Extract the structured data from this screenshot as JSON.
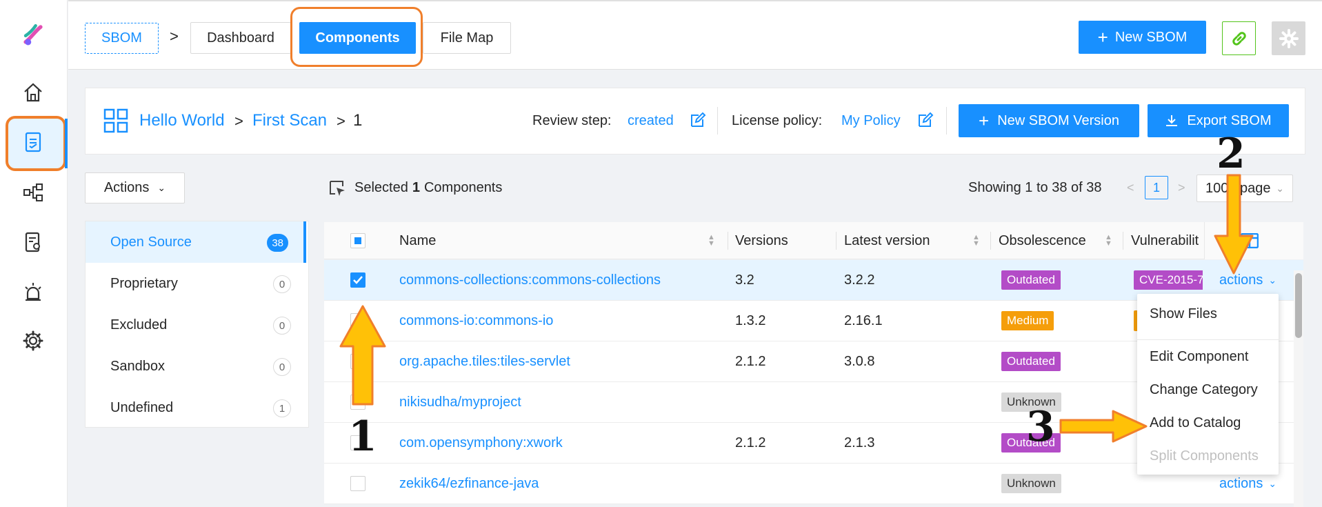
{
  "topbar": {
    "sbom_label": "SBOM",
    "breadcrumb_sep": ">",
    "tabs": [
      "Dashboard",
      "Components",
      "File Map"
    ],
    "new_sbom_label": "New SBOM"
  },
  "header": {
    "project": "Hello World",
    "scan": "First Scan",
    "version": "1",
    "sep": ">",
    "review_label": "Review step:",
    "review_value": "created",
    "license_label": "License policy:",
    "license_value": "My Policy",
    "new_version_label": "New SBOM Version",
    "export_label": "Export SBOM"
  },
  "toolbar": {
    "actions_label": "Actions",
    "selected_prefix": "Selected",
    "selected_count": "1",
    "selected_suffix": "Components",
    "showing": "Showing 1 to 38 of 38",
    "current_page": "1",
    "page_size": "100 / page"
  },
  "categories": [
    {
      "label": "Open Source",
      "count": "38"
    },
    {
      "label": "Proprietary",
      "count": "0"
    },
    {
      "label": "Excluded",
      "count": "0"
    },
    {
      "label": "Sandbox",
      "count": "0"
    },
    {
      "label": "Undefined",
      "count": "1"
    }
  ],
  "table": {
    "headers": [
      "Name",
      "Versions",
      "Latest version",
      "Obsolescence",
      "Vulnerabilit"
    ],
    "rows": [
      {
        "name": "commons-collections:commons-collections",
        "versions": "3.2",
        "latest": "3.2.2",
        "obsolescence": "Outdated",
        "vuln": "CVE-2015-7",
        "action": "actions"
      },
      {
        "name": "commons-io:commons-io",
        "versions": "1.3.2",
        "latest": "2.16.1",
        "obsolescence": "Medium",
        "vuln": "",
        "action": ""
      },
      {
        "name": "org.apache.tiles:tiles-servlet",
        "versions": "2.1.2",
        "latest": "3.0.8",
        "obsolescence": "Outdated",
        "vuln": "",
        "action": ""
      },
      {
        "name": "nikisudha/myproject",
        "versions": "",
        "latest": "",
        "obsolescence": "Unknown",
        "vuln": "",
        "action": ""
      },
      {
        "name": "com.opensymphony:xwork",
        "versions": "2.1.2",
        "latest": "2.1.3",
        "obsolescence": "Outdated",
        "vuln": "",
        "action": ""
      },
      {
        "name": "zekik64/ezfinance-java",
        "versions": "",
        "latest": "",
        "obsolescence": "Unknown",
        "vuln": "",
        "action": "actions"
      }
    ]
  },
  "actions_menu": [
    "Show Files",
    "Edit Component",
    "Change Category",
    "Add to Catalog",
    "Split Components"
  ],
  "annotations": [
    "1",
    "2",
    "3"
  ],
  "colors": {
    "primary": "#1890ff",
    "highlight": "#f07f2b",
    "arrow": "#ffc107"
  }
}
